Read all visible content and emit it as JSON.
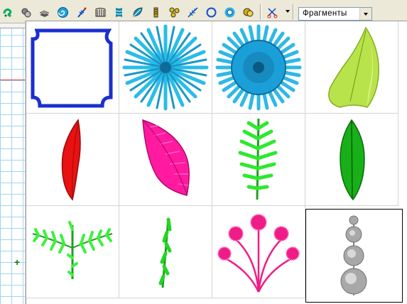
{
  "toolbar": {
    "buttons": [
      {
        "icon": "green-stitch-icon"
      },
      {
        "icon": "stamp-icon"
      },
      {
        "icon": "layers-icon"
      },
      {
        "icon": "spiral-icon"
      },
      {
        "icon": "needle-wand-icon"
      },
      {
        "icon": "comb-icon"
      },
      {
        "icon": "column-icon"
      },
      {
        "icon": "leaf-icon"
      },
      {
        "icon": "screw-icon"
      },
      {
        "icon": "cluster-icon"
      },
      {
        "icon": "feather-icon"
      },
      {
        "icon": "circle-icon"
      },
      {
        "icon": "ring-icon"
      },
      {
        "icon": "monogram-icon"
      },
      {
        "icon": "scissors-icon"
      }
    ],
    "combo": {
      "value": "Фрагменты"
    }
  },
  "fragments": {
    "items": [
      {
        "name": "square-frame",
        "color": "#1a2fd0"
      },
      {
        "name": "blue-sunburst",
        "color": "#2cc4ee"
      },
      {
        "name": "blue-sun-disc",
        "color": "#1b9fd8"
      },
      {
        "name": "lime-leaf",
        "color": "#b9e34a"
      },
      {
        "name": "red-leaf",
        "color": "#e81212"
      },
      {
        "name": "pink-fern-leaf",
        "color": "#ff1aa0"
      },
      {
        "name": "green-fern-sprig",
        "color": "#2ee82e"
      },
      {
        "name": "dark-green-leaf",
        "color": "#18b018"
      },
      {
        "name": "green-branch",
        "color": "#3cf23c"
      },
      {
        "name": "green-stem",
        "color": "#22d622"
      },
      {
        "name": "pink-flower-bouquet",
        "color": "#f01c86"
      },
      {
        "name": "gray-bead-stack",
        "color": "#a8a8a8"
      }
    ],
    "selected_index": 11
  }
}
